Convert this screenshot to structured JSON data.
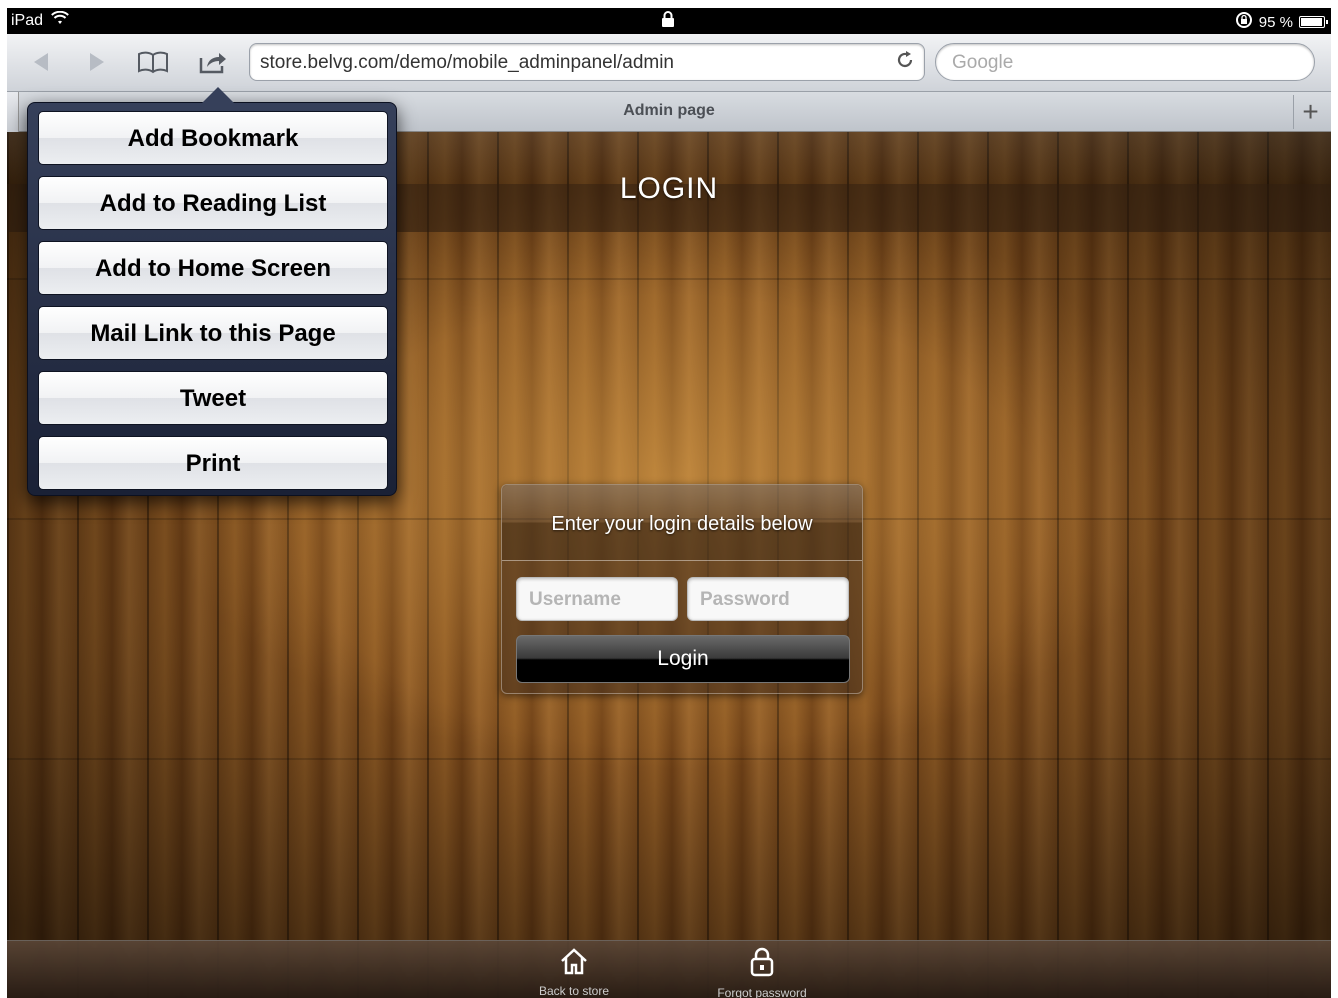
{
  "status_bar": {
    "device": "iPad",
    "battery": "95 %",
    "battery_level": 0.95
  },
  "toolbar": {
    "back_icon": "back-arrow-icon",
    "forward_icon": "forward-arrow-icon",
    "bookmarks_icon": "book-icon",
    "share_icon": "share-icon",
    "url": "store.belvg.com/demo/mobile_adminpanel/admin",
    "search_placeholder": "Google"
  },
  "tab": {
    "title": "Admin page"
  },
  "share_menu": {
    "items": [
      {
        "label": "Add Bookmark"
      },
      {
        "label": "Add to Reading List"
      },
      {
        "label": "Add to Home Screen"
      },
      {
        "label": "Mail Link to this Page"
      },
      {
        "label": "Tweet"
      },
      {
        "label": "Print"
      }
    ]
  },
  "page": {
    "heading": "LOGIN",
    "login_box": {
      "prompt": "Enter your login details below",
      "username_placeholder": "Username",
      "password_placeholder": "Password",
      "submit_label": "Login"
    },
    "bottom_nav": [
      {
        "label": "Back to store",
        "icon": "home-icon"
      },
      {
        "label": "Forgot password",
        "icon": "lock-icon"
      }
    ]
  }
}
